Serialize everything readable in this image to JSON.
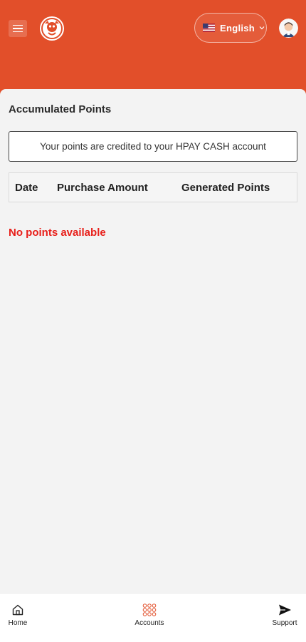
{
  "header": {
    "background_color": "#e24f2a",
    "menu_icon": "hamburger-menu-icon",
    "logo_icon": "brand-logo-icon",
    "language": {
      "label": "English",
      "flag_icon": "us-flag-icon",
      "chevron_icon": "chevron-down-icon"
    },
    "avatar_icon": "user-avatar-icon"
  },
  "main": {
    "title": "Accumulated Points",
    "notice": "Your points are credited to your HPAY CASH account",
    "table": {
      "columns": [
        "Date",
        "Purchase Amount",
        "Generated Points"
      ],
      "rows": []
    },
    "empty_message": "No points available",
    "empty_color": "#e8201b"
  },
  "bottom_nav": {
    "items": [
      {
        "label": "Home",
        "icon": "home-icon"
      },
      {
        "label": "Accounts",
        "icon": "accounts-grid-icon",
        "color": "#e24f2a"
      },
      {
        "label": "Support",
        "icon": "send-icon"
      }
    ]
  }
}
